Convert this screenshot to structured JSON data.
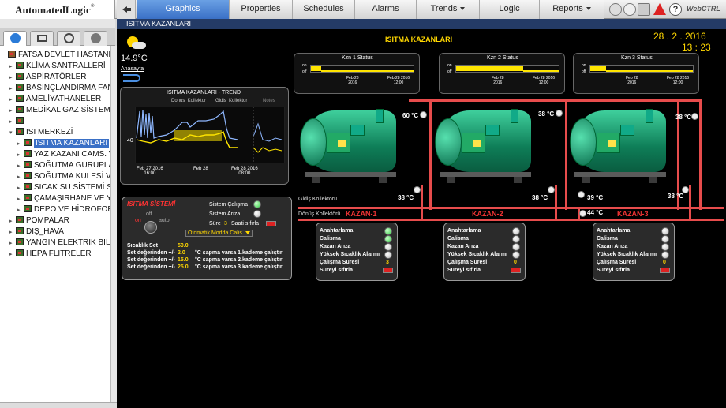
{
  "app": {
    "logo": "AutomatedLogic",
    "logo_mark": "®",
    "brand": "WebCTRL"
  },
  "nav": {
    "tabs": [
      {
        "label": "Graphics",
        "active": true,
        "dropdown": false
      },
      {
        "label": "Properties",
        "active": false,
        "dropdown": false
      },
      {
        "label": "Schedules",
        "active": false,
        "dropdown": false
      },
      {
        "label": "Alarms",
        "active": false,
        "dropdown": false
      },
      {
        "label": "Trends",
        "active": false,
        "dropdown": true
      },
      {
        "label": "Logic",
        "active": false,
        "dropdown": false
      },
      {
        "label": "Reports",
        "active": false,
        "dropdown": true
      }
    ]
  },
  "tree": {
    "items": [
      {
        "label": "FATSA DEVLET HASTANESİ",
        "level": 0,
        "expander": "",
        "icon": "building"
      },
      {
        "label": "KLİMA SANTRALLERİ",
        "level": 1,
        "expander": "▸",
        "icon": "controller"
      },
      {
        "label": "ASPİRATÖRLER",
        "level": 1,
        "expander": "▸",
        "icon": "controller"
      },
      {
        "label": "BASINÇLANDIRMA FANLARI",
        "level": 1,
        "expander": "▸",
        "icon": "controller"
      },
      {
        "label": "AMELİYATHANELER",
        "level": 1,
        "expander": "▸",
        "icon": "controller"
      },
      {
        "label": "MEDİKAL GAZ SİSTEMLERİ",
        "level": 1,
        "expander": "▸",
        "icon": "controller"
      },
      {
        "label": "",
        "level": 1,
        "expander": "▸",
        "icon": "controller"
      },
      {
        "label": "ISI MERKEZİ",
        "level": 1,
        "expander": "▾",
        "icon": "controller"
      },
      {
        "label": "ISITMA KAZANLARI",
        "level": 2,
        "expander": "▸",
        "icon": "controller",
        "selected": true
      },
      {
        "label": "YAZ KAZANI CAMS. V",
        "level": 2,
        "expander": "▸",
        "icon": "controller"
      },
      {
        "label": "SOĞUTMA GURUPLARI",
        "level": 2,
        "expander": "▸",
        "icon": "controller"
      },
      {
        "label": "SOĞUTMA KULESİ VE",
        "level": 2,
        "expander": "▸",
        "icon": "controller"
      },
      {
        "label": "SICAK SU SİSTEMİ SO",
        "level": 2,
        "expander": "▸",
        "icon": "controller"
      },
      {
        "label": "ÇAMAŞIRHANE VE YE",
        "level": 2,
        "expander": "▸",
        "icon": "controller"
      },
      {
        "label": "DEPO VE HİDROFORL",
        "level": 2,
        "expander": "▸",
        "icon": "controller"
      },
      {
        "label": "POMPALAR",
        "level": 1,
        "expander": "▸",
        "icon": "controller"
      },
      {
        "label": "DIŞ_HAVA",
        "level": 1,
        "expander": "▸",
        "icon": "controller"
      },
      {
        "label": "YANGIN ELEKTRİK BİLGİ",
        "level": 1,
        "expander": "▸",
        "icon": "controller"
      },
      {
        "label": "HEPA FLİTRELER",
        "level": 1,
        "expander": "▸",
        "icon": "controller"
      }
    ]
  },
  "breadcrumb": "ISITMA KAZANLARI",
  "graphic": {
    "title": "ISITMA KAZANLARI",
    "date": "28 . 2 . 2016",
    "time": "13 : 23",
    "outside_temp": "14.9°C",
    "home_link": "Anasayfa",
    "trend": {
      "title": "ISITMA KAZANLARI - TREND",
      "legend": [
        "Donus_Kollektor",
        "Gidis_Kollektor",
        "Notes"
      ],
      "y_label": "40",
      "x_labels": [
        "Feb 27 2016\n16:00",
        "Feb 28",
        "Feb 28 2016\n08:00"
      ]
    },
    "status_panels": [
      {
        "title": "Kzn 1 Status",
        "on": "on",
        "off": "off",
        "t1": "Feb 28\n2016",
        "t2": "Feb 28 2016\n12:00",
        "fill": 0.1
      },
      {
        "title": "Kzn 2 Status",
        "on": "on",
        "off": "off",
        "t1": "Feb 28\n2016",
        "t2": "Feb 28 2016\n12:00",
        "fill": 0.65
      },
      {
        "title": "Kzn 3 Status",
        "on": "on",
        "off": "off",
        "t1": "Feb 28\n2016",
        "t2": "Feb 28 2016\n12:00",
        "fill": 0.15
      }
    ],
    "boiler_temps": [
      "60 °C",
      "38 °C",
      "38 °C",
      "38 °C",
      "38 °C",
      "39 °C",
      "38 °C",
      "44 °C"
    ],
    "gidis_label": "Gidiş Kollektörü",
    "donus_label": "Dönüş Kollektörü",
    "kazan_labels": [
      "KAZAN-1",
      "KAZAN-2",
      "KAZAN-3"
    ],
    "system": {
      "title": "ISITMA SİSTEMİ",
      "on": "on",
      "off": "off",
      "auto": "auto",
      "sistem_calisma": "Sistem Çalışma",
      "sistem_ariza": "Sistem Arıza",
      "sure_label": "Süre",
      "sure_value": "3",
      "saati_sifirla": "Saati sıfırla",
      "mode": "Otomatik Modda Calis",
      "sicaklik_set_label": "Sıcaklık Set",
      "sicaklik_set_value": "50.0",
      "sets": [
        {
          "label": "Set değerinden +/-",
          "value": "2.0",
          "desc": "°C sapma varsa 1.kademe çalıştır"
        },
        {
          "label": "Set değerinden +/-",
          "value": "15.0",
          "desc": "°C sapma varsa 2.kademe çalıştır"
        },
        {
          "label": "Set değerinden +/-",
          "value": "25.0",
          "desc": "°C sapma varsa 3.kademe çalıştır"
        }
      ]
    },
    "boilers": [
      {
        "rows": [
          "Anahtarlama",
          "Calisma",
          "Kazan Arıza",
          "Yüksek Sıcaklık Alarmı",
          "Çalışma Süresi",
          "Süreyi sıfırla"
        ],
        "leds": [
          true,
          true,
          false,
          false
        ],
        "runtime": "3"
      },
      {
        "rows": [
          "Anahtarlama",
          "Calisma",
          "Kazan Arıza",
          "Yüksek Sıcaklık Alarmı",
          "Çalışma Süresi",
          "Süreyi sıfırla"
        ],
        "leds": [
          false,
          false,
          false,
          false
        ],
        "runtime": "0"
      },
      {
        "rows": [
          "Anahtarlama",
          "Calisma",
          "Kazan Arıza",
          "Yüksek Sıcaklık Alarmı",
          "Çalışma Süresi",
          "Süreyi sıfırla"
        ],
        "leds": [
          false,
          false,
          false,
          false
        ],
        "runtime": "0"
      }
    ]
  }
}
